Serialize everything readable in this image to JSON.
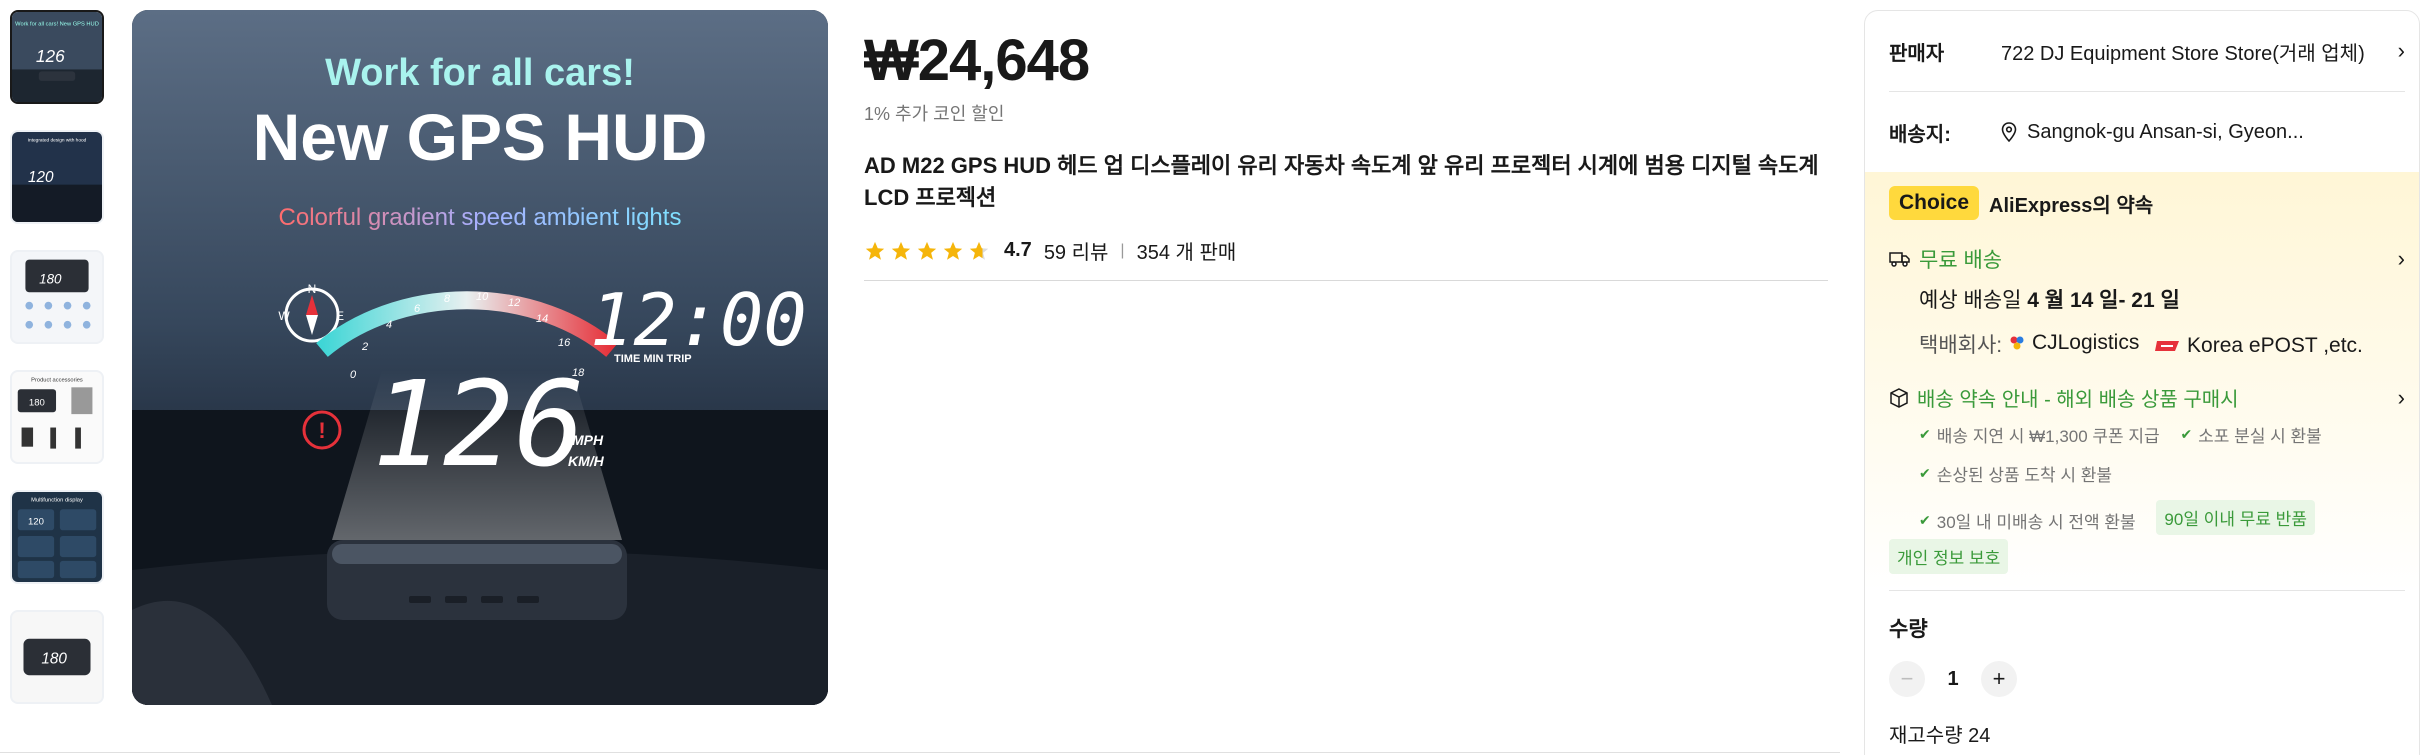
{
  "gallery": {
    "thumb_count": 6,
    "main_image": {
      "headline_small": "Work for all cars!",
      "headline_big": "New GPS HUD",
      "tagline": "Colorful gradient speed ambient lights",
      "clock": "12:00",
      "clock_caption": "TIME MIN TRIP",
      "speed": "126",
      "unit_mph": "MPH",
      "unit_kmh": "KM/H",
      "gauge_ticks": [
        "0",
        "2",
        "4",
        "6",
        "8",
        "10",
        "12",
        "14",
        "16",
        "18"
      ],
      "compass": [
        "N",
        "W",
        "E"
      ]
    },
    "thumbs": [
      {
        "caption": "Work for all cars! New GPS HUD",
        "speed": "126"
      },
      {
        "caption": "Integrated design with hood",
        "speed": "120"
      },
      {
        "caption": "",
        "speed": "180"
      },
      {
        "caption": "Product accessories",
        "speed": "180"
      },
      {
        "caption": "Multifunction display",
        "speed": "120"
      },
      {
        "caption": "",
        "speed": "180"
      }
    ]
  },
  "product": {
    "price": "₩24,648",
    "coin_discount": "1% 추가 코인 할인",
    "title": "AD M22 GPS HUD 헤드 업 디스플레이 유리 자동차 속도계 앞 유리 프로젝터 시계에 범용 디지털 속도계 LCD 프로젝션",
    "rating": "4.7",
    "reviews": "59 리뷰",
    "sold": "354 개 판매",
    "stars_filled": 4.7
  },
  "panel": {
    "seller_label": "판매자",
    "seller_value": "722 DJ Equipment Store Store(거래 업체)",
    "ship_to_label": "배송지:",
    "ship_to_value": "Sangnok-gu Ansan-si, Gyeon...",
    "choice_badge": "Choice",
    "choice_text": "AliExpress의 약속",
    "free_shipping": "무료 배송",
    "delivery_prefix": "예상 배송일 ",
    "delivery_dates": "4 월 14 일- 21 일",
    "carrier_label": "택배회사: ",
    "carrier_1": "CJLogistics",
    "carrier_2": "Korea ePOST ,etc.",
    "promise_title": "배송 약속 안내 - 해외 배송 상품 구매시",
    "promise_items": [
      "배송 지연 시 ₩1,300 쿠폰 지급",
      "소포 분실 시 환불",
      "손상된 상품 도착 시 환불",
      "30일 내 미배송 시 전액 환불"
    ],
    "tags": [
      "90일 이내 무료 반품",
      "개인 정보 보호"
    ],
    "qty_label": "수량",
    "qty_value": "1",
    "stock": "재고수량 24",
    "accent_green": "#3a9a3a",
    "choice_yellow": "#ffd93d"
  }
}
